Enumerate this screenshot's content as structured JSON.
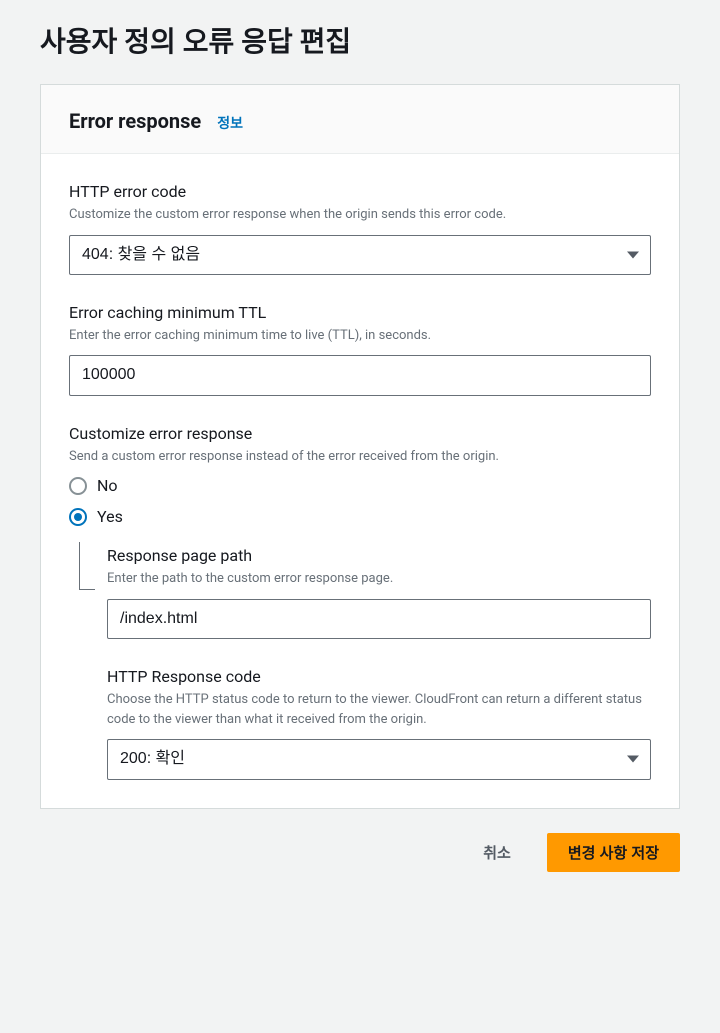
{
  "page": {
    "title": "사용자 정의 오류 응답 편집"
  },
  "panel": {
    "title": "Error response",
    "infoLink": "정보"
  },
  "errorCode": {
    "label": "HTTP error code",
    "hint": "Customize the custom error response when the origin sends this error code.",
    "value": "404: 찾을 수 없음"
  },
  "ttl": {
    "label": "Error caching minimum TTL",
    "hint": "Enter the error caching minimum time to live (TTL), in seconds.",
    "value": "100000"
  },
  "customize": {
    "label": "Customize error response",
    "hint": "Send a custom error response instead of the error received from the origin.",
    "optionNo": "No",
    "optionYes": "Yes"
  },
  "responsePath": {
    "label": "Response page path",
    "hint": "Enter the path to the custom error response page.",
    "value": "/index.html"
  },
  "responseCode": {
    "label": "HTTP Response code",
    "hint": "Choose the HTTP status code to return to the viewer. CloudFront can return a different status code to the viewer than what it received from the origin.",
    "value": "200: 확인"
  },
  "buttons": {
    "cancel": "취소",
    "save": "변경 사항 저장"
  }
}
